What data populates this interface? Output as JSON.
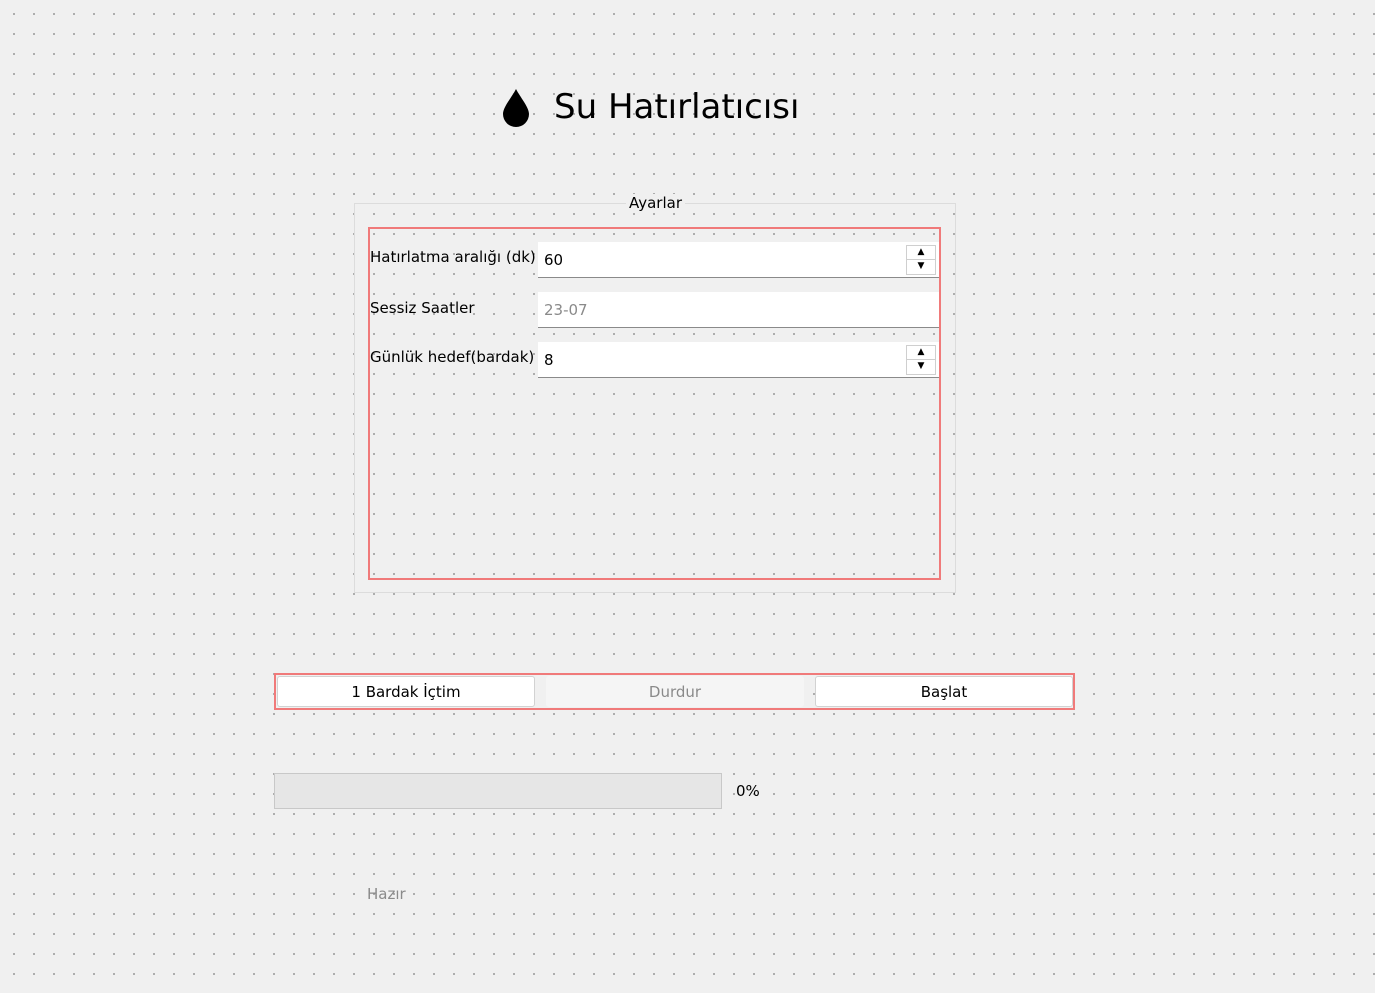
{
  "window": {
    "title": "Su Hatırlatıcısı",
    "title_icon": "water-drop-icon"
  },
  "settings": {
    "group_title": "Ayarlar",
    "reminder_interval": {
      "label": "Hatırlatma aralığı (dk)",
      "value": "60"
    },
    "quiet_hours": {
      "label": "Sessiz Saatler",
      "value": "",
      "placeholder": "23-07"
    },
    "daily_goal": {
      "label": "Günlük hedef(bardak)",
      "value": "8"
    }
  },
  "actions": {
    "drank_label": "1 Bardak İçtim",
    "stop_label": "Durdur",
    "start_label": "Başlat"
  },
  "progress": {
    "value_percent": 0,
    "text": "0%"
  },
  "status": {
    "text": "Hazır"
  },
  "colors": {
    "background": "#f0f0f0",
    "highlight_border": "#f07a7a",
    "disabled_text": "#8a8a8a"
  }
}
